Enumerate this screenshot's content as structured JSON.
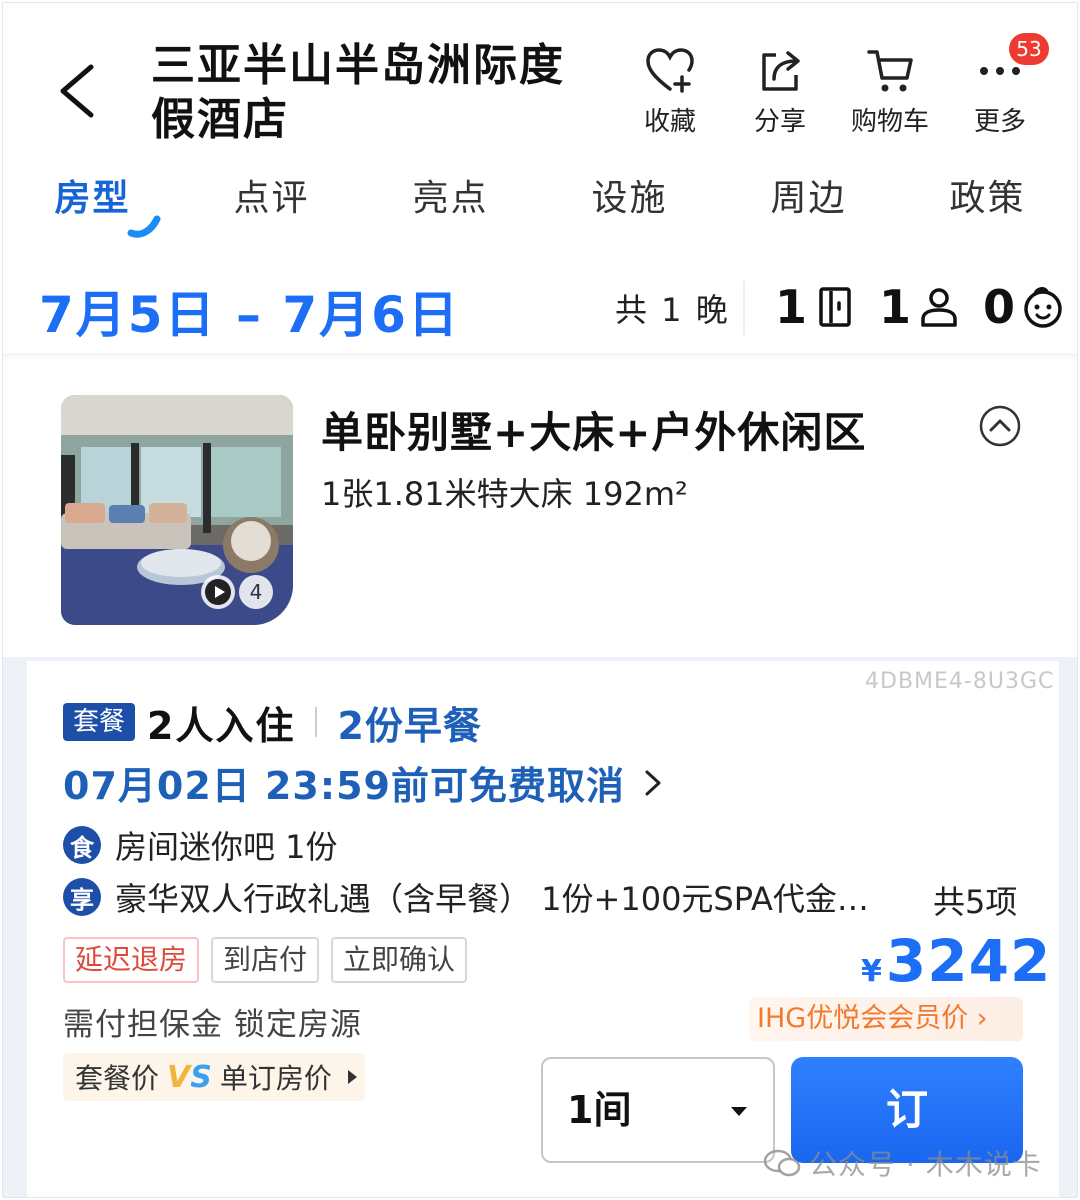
{
  "header": {
    "hotel_name": "三亚半山半岛洲际度假酒店",
    "actions": [
      {
        "label": "收藏",
        "icon": "heart-plus-icon"
      },
      {
        "label": "分享",
        "icon": "share-icon"
      },
      {
        "label": "购物车",
        "icon": "cart-icon"
      },
      {
        "label": "更多",
        "icon": "more-dots-icon",
        "badge": "53"
      }
    ]
  },
  "tabs": [
    {
      "label": "房型",
      "active": true
    },
    {
      "label": "点评"
    },
    {
      "label": "亮点"
    },
    {
      "label": "设施"
    },
    {
      "label": "周边"
    },
    {
      "label": "政策"
    }
  ],
  "stay": {
    "date_range": "7月5日 – 7月6日",
    "nights": "共 1 晚",
    "rooms": "1",
    "adults": "1",
    "children": "0"
  },
  "room": {
    "name": "单卧别墅+大床+户外休闲区",
    "details": "1张1.81米特大床  192m²",
    "photo_count": "4"
  },
  "package": {
    "code": "4DBME4-8U3GC",
    "tag": "套餐",
    "guests": "2人入住",
    "breakfast": "2份早餐",
    "cancellation": "07月02日 23:59前可免费取消",
    "perks": [
      {
        "badge": "食",
        "text": "房间迷你吧 1份"
      },
      {
        "badge": "享",
        "text": "豪华双人行政礼遇（含早餐） 1份+100元SPA代金…"
      }
    ],
    "perk_total": "共5项",
    "tags": [
      "延迟退房",
      "到店付",
      "立即确认"
    ],
    "deposit_note": "需付担保金 锁定房源",
    "compare": {
      "left": "套餐价",
      "vs": "VS",
      "right": "单订房价"
    },
    "price_currency": "¥",
    "price": "3242",
    "member_tag": "IHG优悦会会员价  ›",
    "quantity": "1间",
    "book_label": "订"
  },
  "watermark": "公众号 · 木木说卡",
  "colors": {
    "accent_blue": "#1b6ef5",
    "package_blue": "#1e5fb8",
    "tag_red": "#e04a3c",
    "member_orange": "#f07a2f",
    "badge_red": "#ee3a30"
  }
}
